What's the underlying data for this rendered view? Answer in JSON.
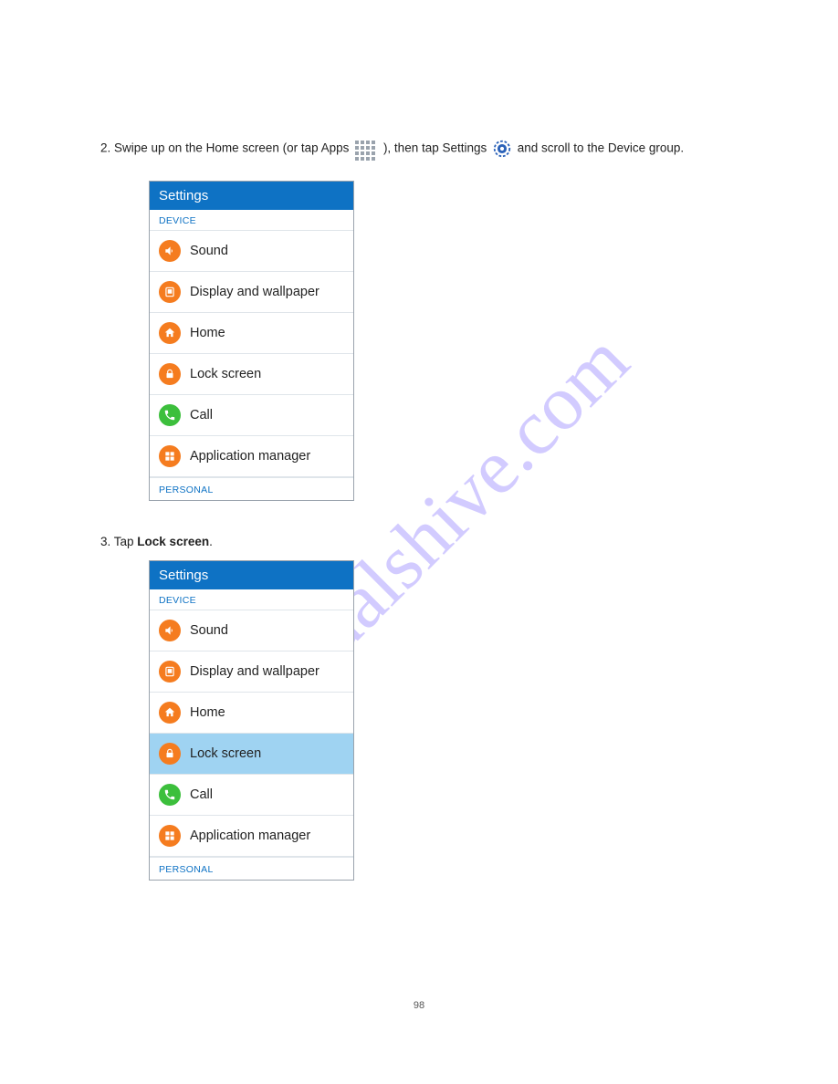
{
  "watermark": "manualshive.com",
  "step1": {
    "prefix": "2.  Swipe up on the Home screen (or tap Apps ",
    "mid": " ), then tap Settings ",
    "suffix": " and scroll to the Device group."
  },
  "step3": {
    "prefix": "3.  Tap ",
    "bold": "Lock screen",
    "suffix": "."
  },
  "panel": {
    "title": "Settings",
    "section_device": "DEVICE",
    "section_personal": "PERSONAL",
    "items": [
      {
        "label": "Sound",
        "icon": "sound",
        "color": "c-orange"
      },
      {
        "label": "Display and wallpaper",
        "icon": "display",
        "color": "c-orange"
      },
      {
        "label": "Home",
        "icon": "home",
        "color": "c-orange"
      },
      {
        "label": "Lock screen",
        "icon": "lock",
        "color": "c-orange"
      },
      {
        "label": "Call",
        "icon": "phone",
        "color": "c-green"
      },
      {
        "label": "Application manager",
        "icon": "apps",
        "color": "c-orange"
      }
    ]
  },
  "page_number": "98"
}
